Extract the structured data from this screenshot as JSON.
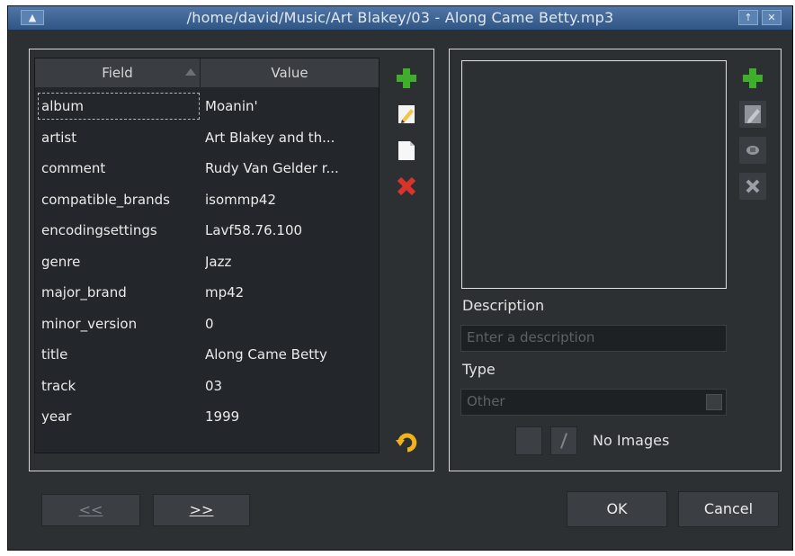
{
  "window": {
    "title": "/home/david/Music/Art Blakey/03 - Along Came Betty.mp3"
  },
  "table": {
    "headers": [
      "Field",
      "Value"
    ],
    "rows": [
      {
        "field": "album",
        "value": "Moanin'"
      },
      {
        "field": "artist",
        "value": "Art Blakey and th..."
      },
      {
        "field": "comment",
        "value": "Rudy Van Gelder r..."
      },
      {
        "field": "compatible_brands",
        "value": "isommp42"
      },
      {
        "field": "encodingsettings",
        "value": "Lavf58.76.100"
      },
      {
        "field": "genre",
        "value": "Jazz"
      },
      {
        "field": "major_brand",
        "value": "mp42"
      },
      {
        "field": "minor_version",
        "value": "0"
      },
      {
        "field": "title",
        "value": "Along Came Betty"
      },
      {
        "field": "track",
        "value": "03"
      },
      {
        "field": "year",
        "value": "1999"
      }
    ]
  },
  "image_panel": {
    "description_label": "Description",
    "description_placeholder": "Enter a description",
    "type_label": "Type",
    "type_value": "Other",
    "no_images_text": "No Images"
  },
  "buttons": {
    "prev": "<<",
    "next": ">>",
    "ok": "OK",
    "cancel": "Cancel"
  },
  "colors": {
    "add": "#3fae2a",
    "delete": "#d9342b",
    "edit": "#f0c64a",
    "revert": "#f2b21c"
  }
}
